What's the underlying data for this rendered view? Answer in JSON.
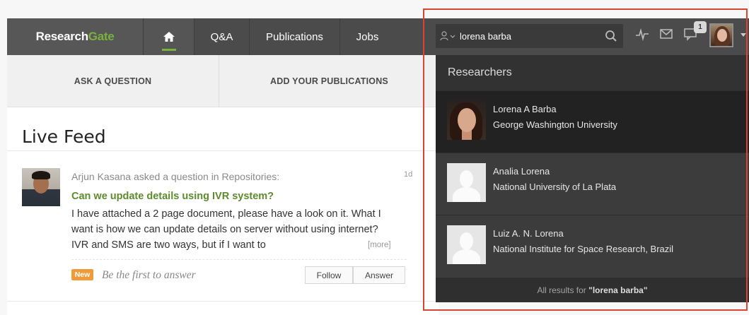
{
  "brand": {
    "name_part1": "Research",
    "name_part2": "Gate",
    "accent_color": "#79b23f"
  },
  "nav": {
    "home_icon": "home-icon",
    "items": [
      {
        "label": "Q&A"
      },
      {
        "label": "Publications"
      },
      {
        "label": "Jobs"
      }
    ]
  },
  "search": {
    "value": "lorena barba",
    "person_icon": "person-icon",
    "search_icon": "search-icon"
  },
  "header_icons": {
    "pulse": "pulse-icon",
    "mail": "mail-icon",
    "messages": "message-icon",
    "notification_count": "1"
  },
  "actions": {
    "ask_label": "ASK A QUESTION",
    "add_label": "ADD YOUR PUBLICATIONS"
  },
  "feed": {
    "title": "Live Feed",
    "item": {
      "meta": "Arjun Kasana asked a question in Repositories:",
      "time": "1d",
      "question": "Can we update details using IVR system?",
      "body": "I have attached a 2 page document, please have a look on it. What I want is how we can update details on server without using internet? IVR and SMS are two ways, but if I want to",
      "more": "[more]",
      "new_badge": "New",
      "first_answer": "Be the first to answer",
      "follow_label": "Follow",
      "answer_label": "Answer",
      "new_badge_color": "#f19b38"
    }
  },
  "dropdown": {
    "header": "Researchers",
    "results": [
      {
        "name": "Lorena A Barba",
        "institution": "George Washington University"
      },
      {
        "name": "Analia Lorena",
        "institution": "National University of La Plata"
      },
      {
        "name": "Luiz A. N. Lorena",
        "institution": "National Institute for Space Research, Brazil"
      }
    ],
    "footer_prefix": "All results for ",
    "footer_query": "\"lorena barba\""
  },
  "highlight_color": "#d84630"
}
